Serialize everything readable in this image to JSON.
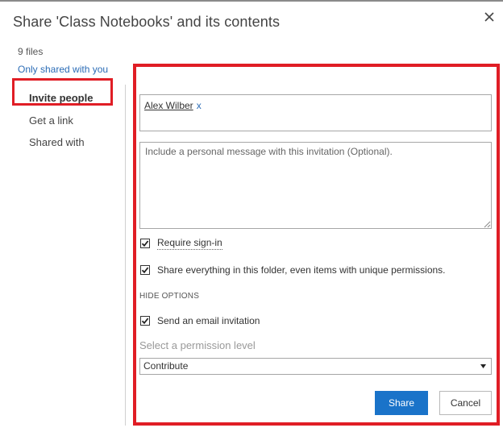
{
  "dialog": {
    "title": "Share 'Class Notebooks' and its contents",
    "close_icon": "close-icon",
    "file_count": "9 files",
    "shared_link": "Only shared with you"
  },
  "nav": {
    "items": [
      {
        "label": "Invite people",
        "active": true
      },
      {
        "label": "Get a link",
        "active": false
      },
      {
        "label": "Shared with",
        "active": false
      }
    ]
  },
  "invite": {
    "people": [
      {
        "name": "Alex Wilber",
        "remove": "x"
      }
    ],
    "message": {
      "value": "",
      "placeholder": "Include a personal message with this invitation (Optional)."
    },
    "require_signin": {
      "label": "Require sign-in",
      "checked": true
    },
    "share_everything": {
      "label": "Share everything in this folder, even items with unique permissions.",
      "checked": true
    },
    "hide_options": "HIDE OPTIONS",
    "send_email": {
      "label": "Send an email invitation",
      "checked": true
    },
    "permission": {
      "label": "Select a permission level",
      "selected": "Contribute"
    },
    "share_label": "Share",
    "cancel_label": "Cancel"
  },
  "colors": {
    "accent": "#1a73c9",
    "link": "#2b6cb6",
    "highlight": "#e01d25"
  }
}
